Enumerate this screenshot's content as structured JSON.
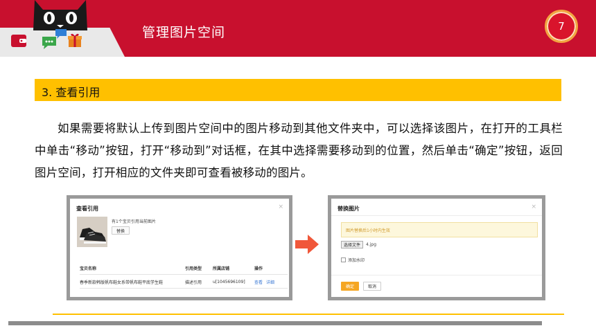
{
  "header": {
    "title": "管理图片空间",
    "page_number": "7",
    "brand_color": "#c8102e",
    "icons": [
      "tmall-cat-logo-icon",
      "wallet-icon",
      "chat-bubble-icon",
      "gift-icon"
    ]
  },
  "section": {
    "title": "3. 查看引用",
    "color": "#ffc000"
  },
  "paragraph": "如果需要将默认上传到图片空间中的图片移动到其他文件夹中，可以选择该图片，在打开的工具栏中单击“移动”按钮，打开“移动到”对话框，在其中选择需要移动到的位置，然后单击“确定”按钮，返回图片空间，打开相应的文件夹即可查看被移动的图片。",
  "left_dialog": {
    "title": "查看引用",
    "close": "×",
    "note": "有1个宝贝引用当前图片",
    "replace_button": "替换",
    "table": {
      "headers": [
        "宝贝名称",
        "引用类型",
        "所属店铺",
        "操作"
      ],
      "rows": [
        {
          "name": "春季新款韩版帆布鞋女系带帆布鞋平底学生鞋",
          "type": "描述引用",
          "shop": "u[1045696109]",
          "actions": [
            "查看",
            "详细"
          ]
        }
      ]
    }
  },
  "right_dialog": {
    "title": "替换图片",
    "close": "×",
    "notice": "图片替换后1小时内生效",
    "choose_file_button": "选择文件",
    "file_name": "4.jpg",
    "watermark_label": "添加水印",
    "confirm_button": "确定",
    "cancel_button": "取消"
  },
  "arrow_color": "#f0573a"
}
